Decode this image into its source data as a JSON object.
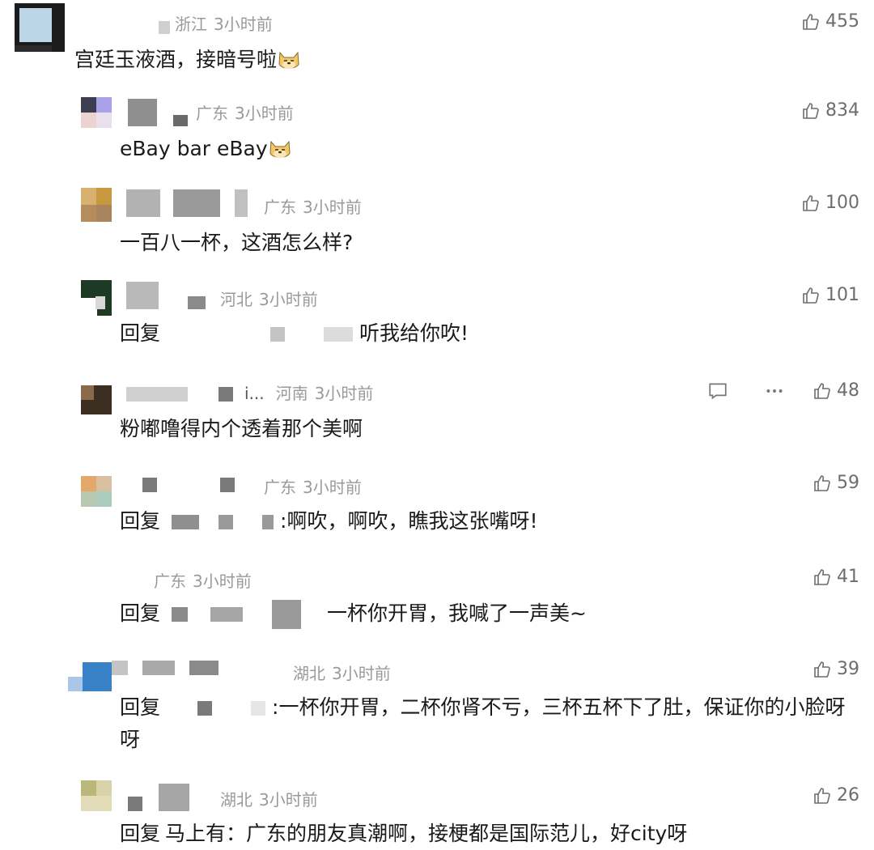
{
  "comments": [
    {
      "region": "浙江",
      "time": "3小时前",
      "likes": "455",
      "text": "宫廷玉液酒，接暗号啦"
    },
    {
      "region": "广东",
      "time": "3小时前",
      "likes": "834",
      "text": "eBay bar eBay"
    },
    {
      "region": "广东",
      "time": "3小时前",
      "likes": "100",
      "text": "一百八一杯，这酒怎么样?"
    },
    {
      "region": "河北",
      "time": "3小时前",
      "likes": "101",
      "reply_word": "回复",
      "text": "听我给你吹!"
    },
    {
      "name_suffix": "i...",
      "region": "河南",
      "time": "3小时前",
      "likes": "48",
      "text": "粉嘟噜得内个透着那个美啊"
    },
    {
      "region": "广东",
      "time": "3小时前",
      "likes": "59",
      "reply_word": "回复",
      "text": ":啊吹，啊吹，瞧我这张嘴呀!"
    },
    {
      "region": "广东",
      "time": "3小时前",
      "likes": "41",
      "reply_word": "回复",
      "text": "一杯你开胃，我喊了一声美~"
    },
    {
      "region": "湖北",
      "time": "3小时前",
      "likes": "39",
      "reply_word": "回复",
      "text": ":一杯你开胃，二杯你肾不亏，三杯五杯下了肚，保证你的小脸呀呀"
    },
    {
      "region": "湖北",
      "time": "3小时前",
      "likes": "26",
      "reply_word": "回复",
      "text": "马上有：广东的朋友真潮啊，接梗都是国际范儿，好city呀"
    }
  ],
  "icons": {
    "like": "thumbs-up-icon",
    "reply": "comment-bubble-icon",
    "more": "more-dots-icon",
    "emoji": "doge-emoji-icon"
  },
  "colors": {
    "meta": "#9a9a9a",
    "text": "#1a1a1a",
    "like": "#6d6d6d"
  }
}
